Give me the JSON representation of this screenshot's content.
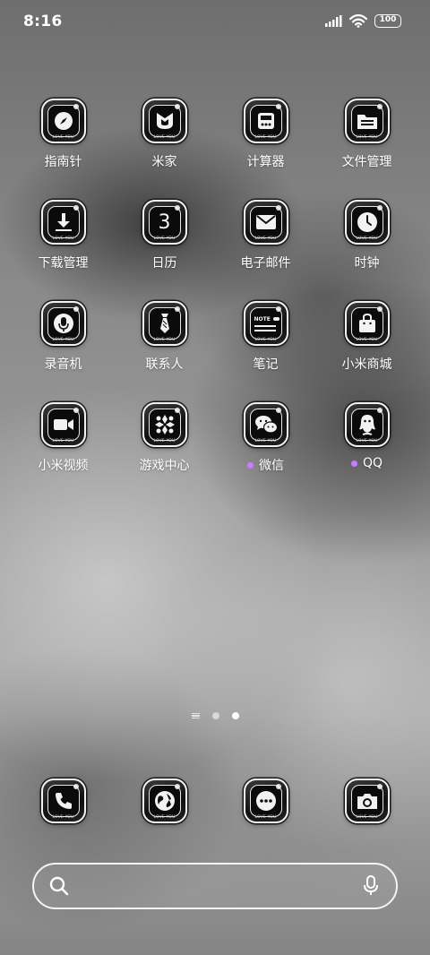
{
  "status_bar": {
    "time": "8:16",
    "battery": "100"
  },
  "apps": [
    {
      "label": "指南针",
      "icon": "compass-icon"
    },
    {
      "label": "米家",
      "icon": "mijia-icon"
    },
    {
      "label": "计算器",
      "icon": "calculator-icon"
    },
    {
      "label": "文件管理",
      "icon": "folder-icon"
    },
    {
      "label": "下载管理",
      "icon": "download-icon"
    },
    {
      "label": "日历",
      "icon": "calendar-icon",
      "icon_text": "3"
    },
    {
      "label": "电子邮件",
      "icon": "mail-icon"
    },
    {
      "label": "时钟",
      "icon": "clock-icon"
    },
    {
      "label": "录音机",
      "icon": "microphone-icon"
    },
    {
      "label": "联系人",
      "icon": "contacts-icon"
    },
    {
      "label": "笔记",
      "icon": "notes-icon",
      "icon_text": "NOTE"
    },
    {
      "label": "小米商城",
      "icon": "shopping-bag-icon"
    },
    {
      "label": "小米视频",
      "icon": "video-camera-icon"
    },
    {
      "label": "游戏中心",
      "icon": "game-center-icon"
    },
    {
      "label": "微信",
      "icon": "wechat-icon",
      "badge": true
    },
    {
      "label": "QQ",
      "icon": "qq-icon",
      "badge": true
    }
  ],
  "icon_tag": "LOVE YOU",
  "page_indicator": {
    "pages": 2,
    "active": 2
  },
  "dock": [
    {
      "icon": "phone-icon"
    },
    {
      "icon": "browser-icon"
    },
    {
      "icon": "messages-icon"
    },
    {
      "icon": "camera-icon"
    }
  ],
  "search": {
    "icon": "search-icon",
    "voice_icon": "microphone-icon"
  },
  "colors": {
    "badge": "#c77dff",
    "icon_border": "#f2f2f2",
    "icon_fill": "#111111"
  }
}
